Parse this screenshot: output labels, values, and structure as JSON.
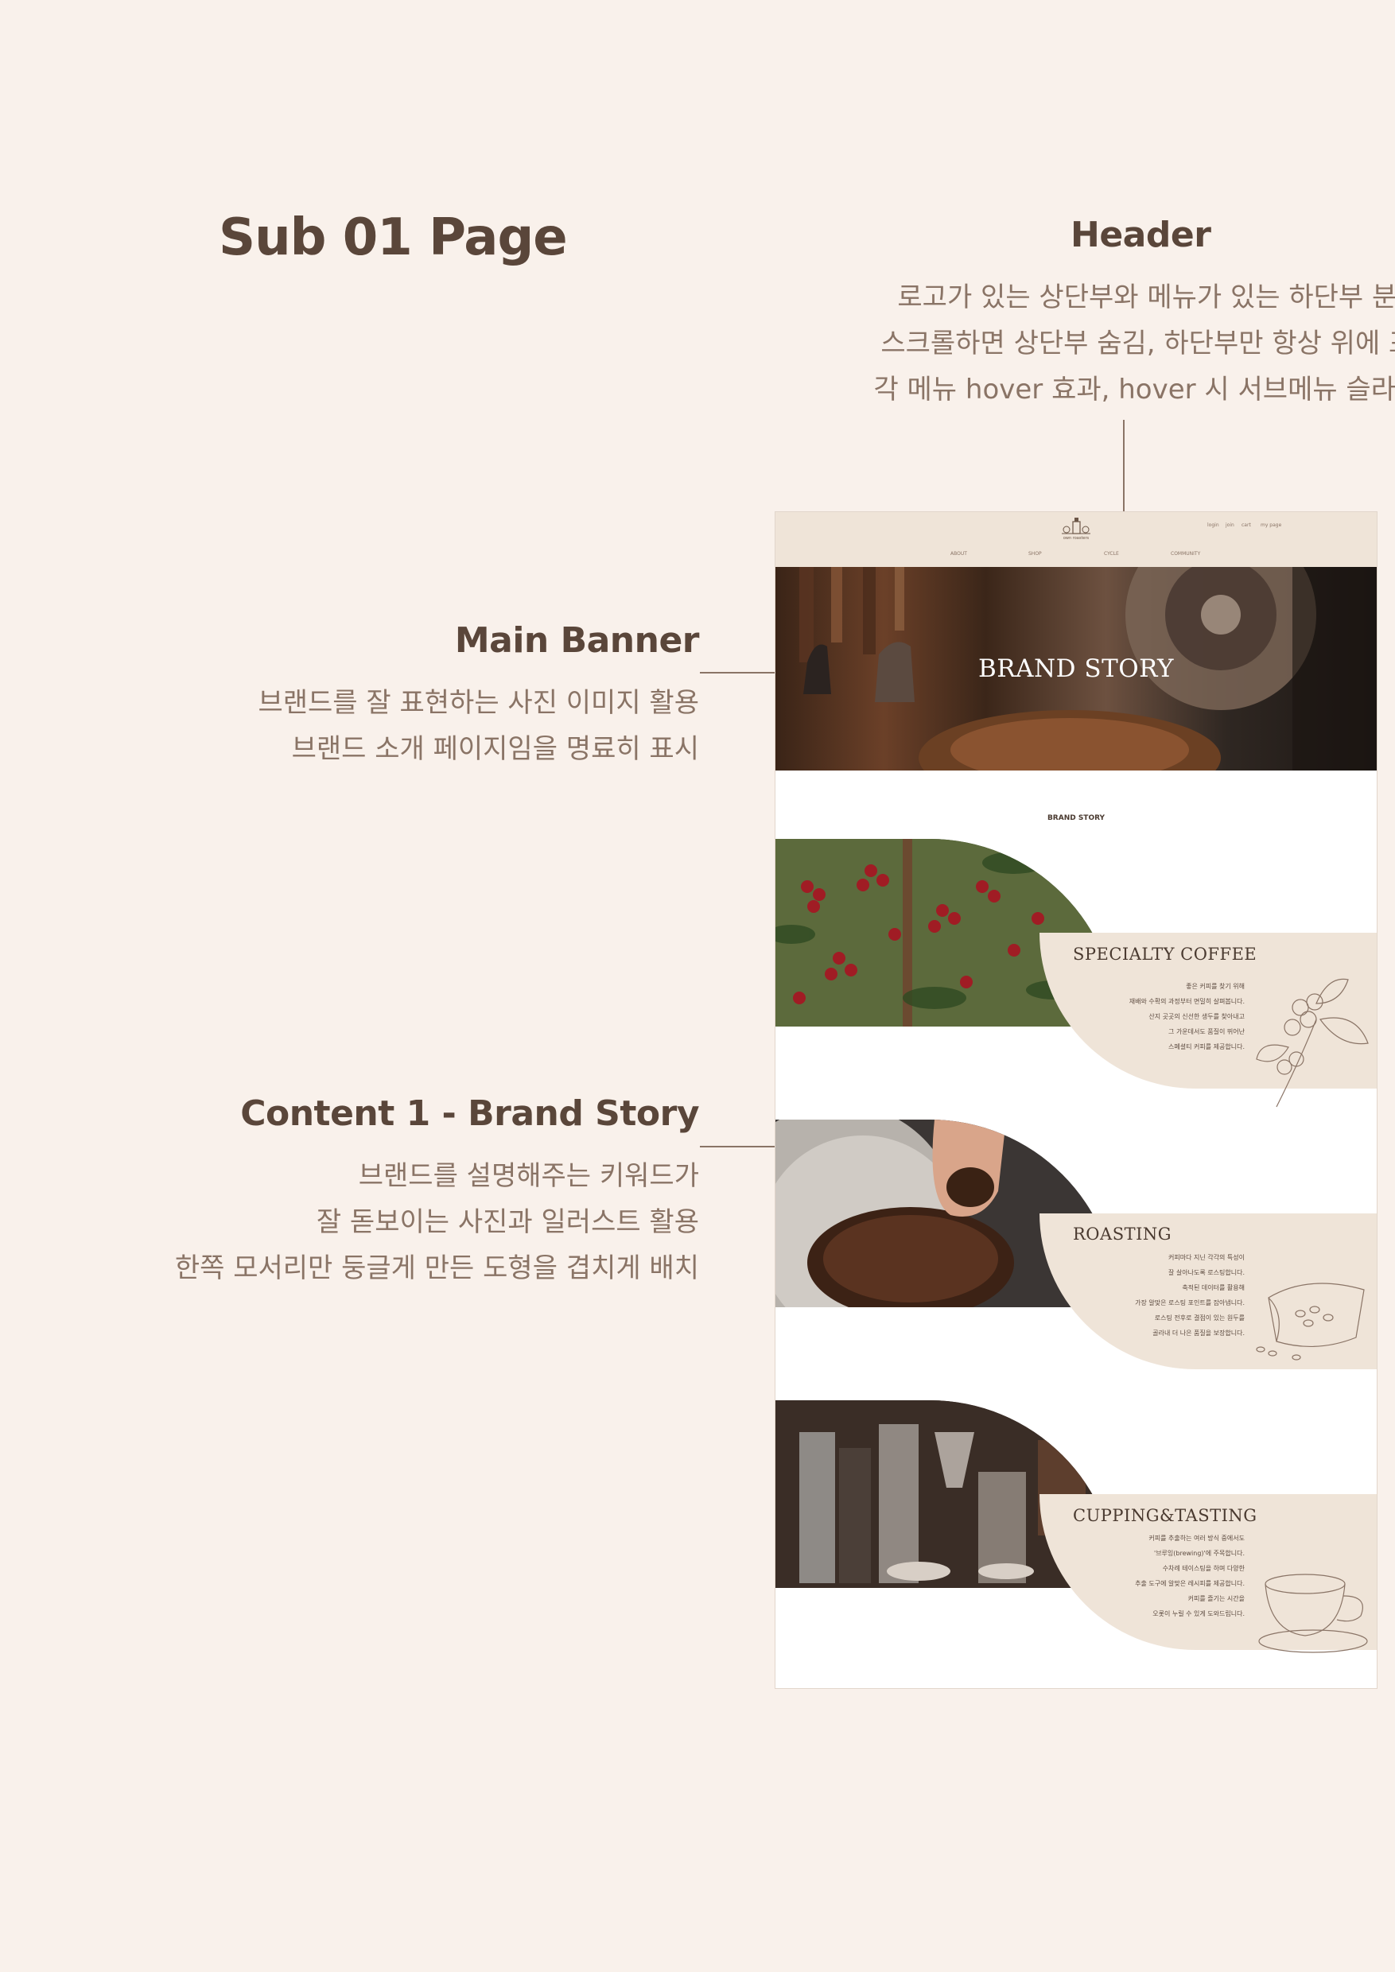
{
  "page_title": "Sub 01 Page",
  "header_note": {
    "title": "Header",
    "lines": [
      "로고가 있는 상단부와 메뉴가 있는 하단부 분리",
      "스크롤하면 상단부 숨김, 하단부만 항상 위에 표시",
      "각 메뉴 hover 효과, hover 시 서브메뉴 슬라이드"
    ]
  },
  "banner_note": {
    "title": "Main Banner",
    "lines": [
      "브랜드를 잘 표현하는 사진 이미지 활용",
      "브랜드 소개 페이지임을 명료히 표시"
    ]
  },
  "content_note": {
    "title": "Content 1 - Brand Story",
    "lines": [
      "브랜드를 설명해주는 키워드가",
      "잘 돋보이는 사진과 일러스트 활용",
      "한쪽 모서리만 둥글게 만든 도형을 겹치게 배치"
    ]
  },
  "mockup": {
    "header": {
      "logo_text": "own roasters",
      "util_links": [
        "login",
        "join",
        "cart",
        "my page"
      ],
      "nav": [
        "ABOUT",
        "SHOP",
        "CYCLE",
        "COMMUNITY"
      ]
    },
    "banner_title": "BRAND STORY",
    "section_label": "BRAND STORY",
    "sections": [
      {
        "title": "SPECIALTY COFFEE",
        "lines": [
          "좋은 커피를 찾기 위해",
          "재배와 수확의 과정부터 면밀히 살펴봅니다.",
          "산지 곳곳의 신선한 생두를 찾아내고",
          "그 가운데서도 품질이 뛰어난",
          "스페셜티 커피를 제공합니다."
        ]
      },
      {
        "title": "ROASTING",
        "lines": [
          "커피마다 지닌 각각의 특성이",
          "잘 살아나도록 로스팅합니다.",
          "축적된 데이터를 활용해",
          "가장 알맞은 로스팅 포인트를 잡아냅니다.",
          "로스팅 전후로 결점이 있는 원두를",
          "골라내 더 나은 품질을 보장합니다."
        ]
      },
      {
        "title": "CUPPING&TASTING",
        "lines": [
          "커피를 추출하는 여러 방식 중에서도",
          "'브루잉(brewing)'에 주목합니다.",
          "수차례 테이스팅을 하며 다양한",
          "추출 도구에 알맞은 레시피를 제공합니다.",
          "커피를 즐기는 시간을",
          "오롯이 누릴 수 있게 도와드립니다."
        ]
      }
    ]
  },
  "colors": {
    "background": "#f9f1eb",
    "title": "#5a463a",
    "text": "#8a7466",
    "card": "#efe4d8"
  }
}
